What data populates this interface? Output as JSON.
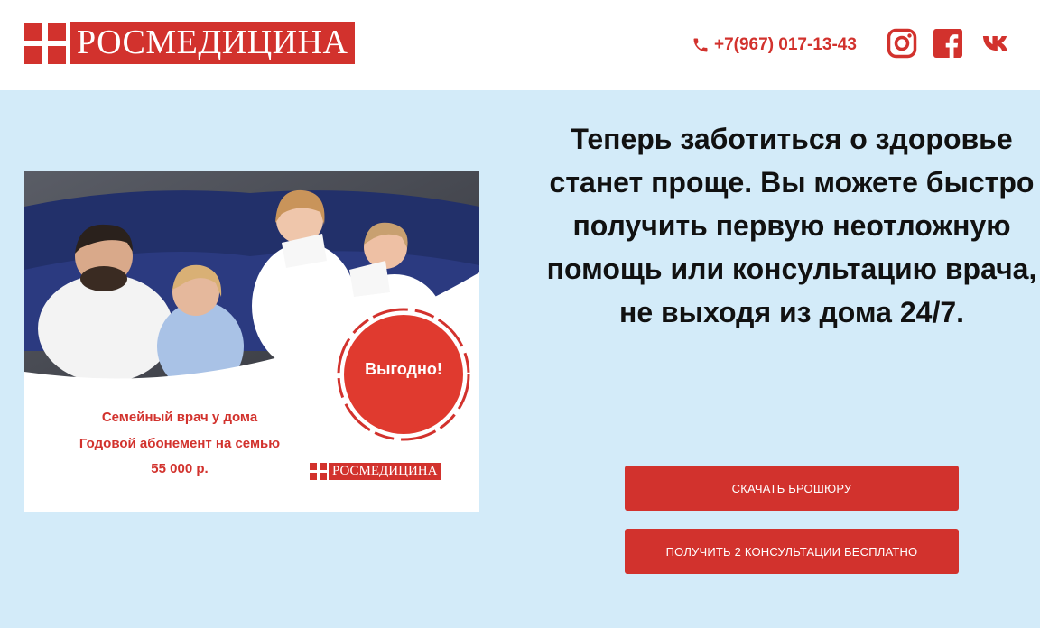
{
  "header": {
    "logo_text": "РОСМЕДИЦИНА",
    "phone": "+7(967) 017-13-43",
    "social_icons": [
      "instagram-icon",
      "facebook-icon",
      "vk-icon"
    ]
  },
  "promo": {
    "badge_text": "Выгодно!",
    "line1": "Семейный врач у дома",
    "line2": "Годовой абонемент на семью",
    "price": "55 000 р.",
    "logo_text": "РОСМЕДИЦИНА"
  },
  "main": {
    "headline": "Теперь заботиться о здоровье станет проще. Вы можете быстро получить первую неотложную помощь или консультацию врача, не выходя из дома 24/7.",
    "button_brochure": "СКАЧАТЬ БРОШЮРУ",
    "button_consult": "ПОЛУЧИТЬ 2 КОНСУЛЬТАЦИИ БЕСПЛАТНО"
  },
  "colors": {
    "brand_red": "#d2322d",
    "page_background": "#d3ebf9",
    "header_background": "#ffffff"
  }
}
